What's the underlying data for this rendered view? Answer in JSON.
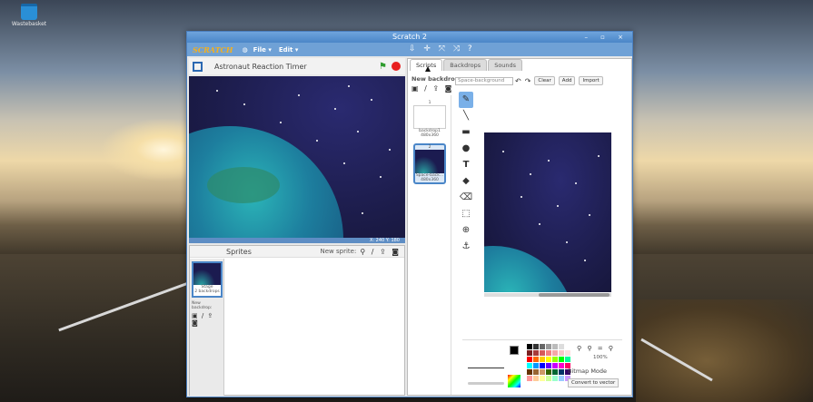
{
  "desktop": {
    "trash_label": "Wastebasket"
  },
  "window": {
    "title": "Scratch 2",
    "controls": "– ▫ ×"
  },
  "menubar": {
    "logo": "SCRATCH",
    "file": "File ▾",
    "edit": "Edit ▾",
    "tools": "⇩ ✛ ⤧ ⤨ ?"
  },
  "stage": {
    "project_title": "Astronaut Reaction Timer",
    "coords": "X: 240  Y: 180"
  },
  "sprites": {
    "title": "Sprites",
    "new_sprite_label": "New sprite:",
    "new_sprite_icons": "⚲ / ⇪ ◙",
    "stage_label": "Stage",
    "stage_backdrops": "2 backdrops",
    "new_backdrop_small": "New backdrop:",
    "nb_icons": "▣ / ⇪ ◙"
  },
  "editor": {
    "tabs": [
      {
        "label": "Scripts"
      },
      {
        "label": "Backdrops"
      },
      {
        "label": "Sounds"
      }
    ],
    "new_backdrop_label": "New backdrop:",
    "nb_row_icons": "▣ / ⇪ ◙",
    "name_value": "Space-background",
    "undo": "↶",
    "redo": "↷",
    "clear_label": "Clear",
    "add_label": "Add",
    "import_label": "Import",
    "backdrops": [
      {
        "index": "1",
        "name": "backdrop1",
        "size": "480x360"
      },
      {
        "index": "2",
        "name": "Space-back...",
        "size": "480x360"
      }
    ],
    "zoom_pct": "100%",
    "bitmap_mode": "Bitmap Mode",
    "convert": "Convert to vector"
  },
  "palette_colors": [
    "#000000",
    "#333333",
    "#666666",
    "#999999",
    "#bbbbbb",
    "#dddddd",
    "#ffffff",
    "#7a1f1f",
    "#a83a3a",
    "#d65a5a",
    "#f08080",
    "#f5a6a6",
    "#fac8c8",
    "#ffe0e0",
    "#ff0000",
    "#ff6600",
    "#ffcc00",
    "#ffff00",
    "#99ff00",
    "#00ff00",
    "#00ff99",
    "#00ffff",
    "#0099ff",
    "#0000ff",
    "#6600ff",
    "#cc00ff",
    "#ff00cc",
    "#ff0066",
    "#663300",
    "#996633",
    "#cc9966",
    "#336600",
    "#006633",
    "#003366",
    "#330066",
    "#ff9999",
    "#ffcc99",
    "#ffff99",
    "#ccff99",
    "#99ffcc",
    "#99ccff",
    "#cc99ff"
  ]
}
